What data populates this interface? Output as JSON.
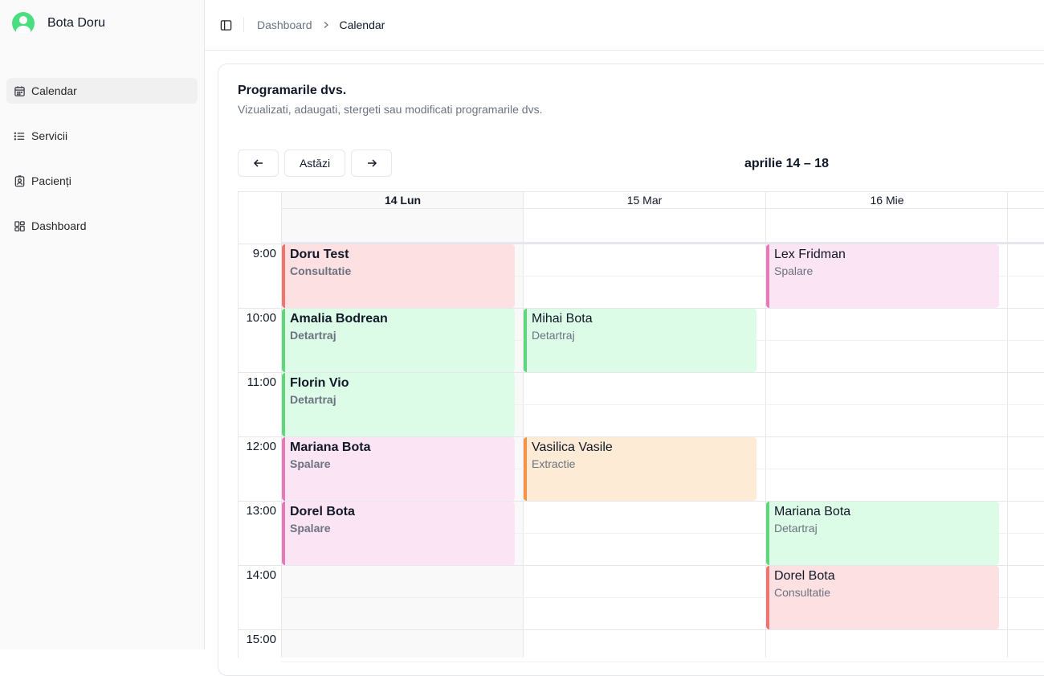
{
  "user": {
    "name": "Bota Doru"
  },
  "sidebar": {
    "items": [
      {
        "label": "Calendar",
        "icon": "calendar-icon",
        "active": true
      },
      {
        "label": "Servicii",
        "icon": "list-icon",
        "active": false
      },
      {
        "label": "Pacienți",
        "icon": "contact-icon",
        "active": false
      },
      {
        "label": "Dashboard",
        "icon": "dashboard-icon",
        "active": false
      }
    ]
  },
  "header": {
    "breadcrumb": {
      "parent": "Dashboard",
      "current": "Calendar"
    }
  },
  "card": {
    "title": "Programarile dvs.",
    "subtitle": "Vizualizati, adaugati, stergeti sau modificati programarile dvs."
  },
  "toolbar": {
    "prev_icon": "arrow-left-icon",
    "today_label": "Astăzi",
    "next_icon": "arrow-right-icon",
    "range_label": "aprilie 14 – 18"
  },
  "calendar": {
    "days": [
      {
        "label": "14 Lun",
        "today": true
      },
      {
        "label": "15 Mar",
        "today": false
      },
      {
        "label": "16 Mie",
        "today": false
      }
    ],
    "hours": [
      "9:00",
      "10:00",
      "11:00",
      "12:00",
      "13:00",
      "14:00",
      "15:00"
    ],
    "events": [
      {
        "day": 0,
        "start": "9:00",
        "end": "10:00",
        "title": "Doru Test",
        "service": "Consultatie",
        "color": "red"
      },
      {
        "day": 0,
        "start": "10:00",
        "end": "11:00",
        "title": "Amalia Bodrean",
        "service": "Detartraj",
        "color": "green"
      },
      {
        "day": 0,
        "start": "11:00",
        "end": "12:00",
        "title": "Florin Vio",
        "service": "Detartraj",
        "color": "green"
      },
      {
        "day": 0,
        "start": "12:00",
        "end": "13:00",
        "title": "Mariana Bota",
        "service": "Spalare",
        "color": "pink"
      },
      {
        "day": 0,
        "start": "13:00",
        "end": "14:00",
        "title": "Dorel Bota",
        "service": "Spalare",
        "color": "pink"
      },
      {
        "day": 1,
        "start": "10:00",
        "end": "11:00",
        "title": "Mihai Bota",
        "service": "Detartraj",
        "color": "green"
      },
      {
        "day": 1,
        "start": "12:00",
        "end": "13:00",
        "title": "Vasilica Vasile",
        "service": "Extractie",
        "color": "orange"
      },
      {
        "day": 2,
        "start": "9:00",
        "end": "10:00",
        "title": "Lex Fridman",
        "service": "Spalare",
        "color": "pink"
      },
      {
        "day": 2,
        "start": "13:00",
        "end": "14:00",
        "title": "Mariana Bota",
        "service": "Detartraj",
        "color": "green"
      },
      {
        "day": 2,
        "start": "14:00",
        "end": "15:00",
        "title": "Dorel Bota",
        "service": "Consultatie",
        "color": "red"
      }
    ]
  },
  "colors": {
    "red": "#fde0e2",
    "green": "#dcfce7",
    "pink": "#fbe4f3",
    "orange": "#fdebd6",
    "accent": "#4ade80"
  }
}
